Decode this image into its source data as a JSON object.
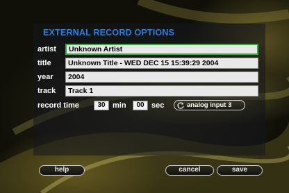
{
  "panel": {
    "title": "EXTERNAL RECORD OPTIONS"
  },
  "fields": {
    "artist": {
      "label": "artist",
      "value": "Unknown Artist"
    },
    "title": {
      "label": "title",
      "value": "Unknown Title - WED DEC 15 15:39:29 2004"
    },
    "year": {
      "label": "year",
      "value": "2004"
    },
    "track": {
      "label": "track",
      "value": "Track 1"
    }
  },
  "record_time": {
    "label": "record time",
    "minutes": "30",
    "min_label": "min",
    "seconds": "00",
    "sec_label": "sec",
    "source": "analog input 3",
    "source_icon": "refresh-icon"
  },
  "buttons": {
    "help": "help",
    "cancel": "cancel",
    "save": "save"
  },
  "colors": {
    "accent": "#2e7fd6",
    "focus": "#2fae3a",
    "field_bg": "#e8e8e8"
  }
}
